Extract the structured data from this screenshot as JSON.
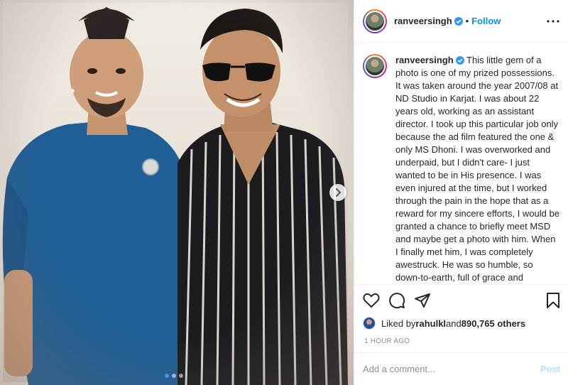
{
  "post": {
    "username": "ranveersingh",
    "follow_label": "Follow",
    "bullet": "•",
    "caption": "This little gem of a photo is one of my prized possessions. It was taken around the year 2007/08 at ND Studio in Karjat. I was about 22 years old, working as an assistant director. I took up this particular job only because the ad film featured the one & only MS Dhoni. I was overworked and underpaid, but I didn't care- I just wanted to be in His presence. I was even injured at the time, but I worked through the pain in the hope that as a reward for my sincere efforts, I would be granted a chance to briefly meet MSD and maybe get a photo with him. When I finally met him, I was completely awestruck. He was so humble, so down-to-earth, full of grace and",
    "likes": {
      "prefix": "Liked by ",
      "user": "rahulkl",
      "middle": " and ",
      "count": "890,765 others"
    },
    "timestamp": "1 HOUR AGO",
    "add_comment_placeholder": "Add a comment...",
    "post_label": "Post"
  },
  "carousel": {
    "slide_count": 3,
    "active_slide": 1
  },
  "colors": {
    "accent": "#0095f6",
    "verified": "#3897f0",
    "post_disabled": "#b2dffc",
    "muted": "#8e8e8e"
  },
  "icons": [
    "verified-badge-icon",
    "more-options-icon",
    "heart-icon",
    "comment-icon",
    "share-icon",
    "bookmark-icon",
    "chevron-right-icon"
  ]
}
